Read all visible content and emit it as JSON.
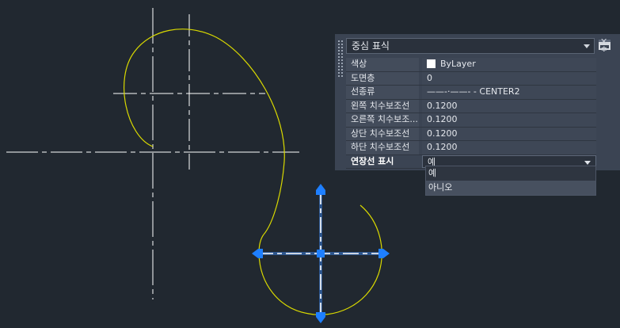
{
  "colors": {
    "background": "#212830",
    "geometry": "#d9d900",
    "centerline": "#ffffff",
    "grip": "#1e7fff"
  },
  "palette": {
    "object_type": "중심 표식",
    "quick_select_icon": "quick-select-icon",
    "close_icon": "close-icon",
    "gear_icon": "gear-icon",
    "properties": [
      {
        "label": "색상",
        "value": "ByLayer",
        "swatch": "#ffffff"
      },
      {
        "label": "도면층",
        "value": "0"
      },
      {
        "label": "선종류",
        "value": "——-·——- - CENTER2"
      },
      {
        "label": "왼쪽 치수보조선",
        "value": "0.1200"
      },
      {
        "label": "오른쪽 치수보조...",
        "value": "0.1200"
      },
      {
        "label": "상단 치수보조선",
        "value": "0.1200"
      },
      {
        "label": "하단 치수보조선",
        "value": "0.1200"
      },
      {
        "label": "연장선 표시",
        "value": "예"
      }
    ],
    "dropdown_options": [
      "예",
      "아니오"
    ],
    "dropdown_highlighted": "아니오"
  }
}
